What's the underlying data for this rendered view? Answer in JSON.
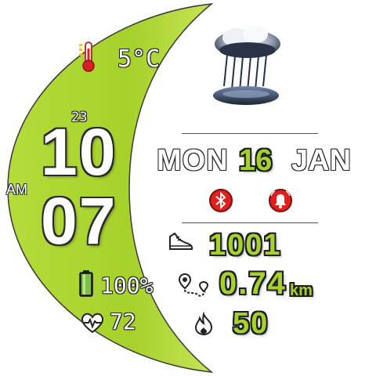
{
  "weather": {
    "icon": "rain-cloud-icon",
    "temperature": "5°C",
    "thermometer_icon": "thermometer-icon"
  },
  "time": {
    "day_of_year": "23",
    "hours": "10",
    "minutes": "07",
    "ampm": "AM"
  },
  "date": {
    "day_name": "MON",
    "day_number": "16",
    "month": "JAN"
  },
  "status": {
    "bluetooth_icon": "bluetooth-icon",
    "alarm_icon": "alarm-icon"
  },
  "activity": {
    "steps": "1001",
    "steps_icon": "shoe-icon",
    "distance": "0.74",
    "distance_unit": "km",
    "distance_icon": "route-icon",
    "calories": "50",
    "calories_icon": "flame-icon"
  },
  "battery": {
    "percent_text": "100%",
    "level": 1.0,
    "icon": "battery-icon"
  },
  "heart": {
    "bpm": "72",
    "icon": "heart-rate-icon"
  },
  "colors": {
    "accent_green": "#a6d12b",
    "badge_red": "#e0201c"
  }
}
